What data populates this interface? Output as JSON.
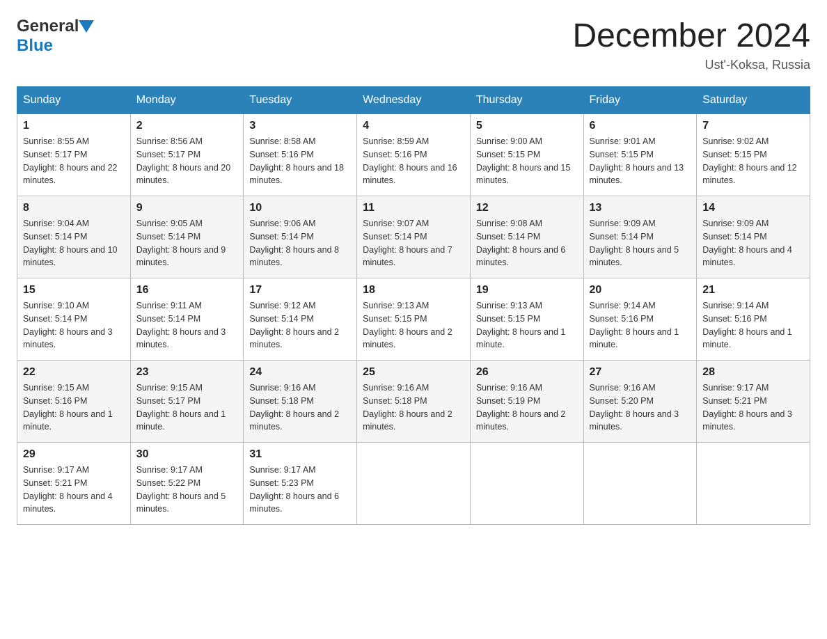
{
  "header": {
    "logo_general": "General",
    "logo_blue": "Blue",
    "month_title": "December 2024",
    "location": "Ust'-Koksa, Russia"
  },
  "days_of_week": [
    "Sunday",
    "Monday",
    "Tuesday",
    "Wednesday",
    "Thursday",
    "Friday",
    "Saturday"
  ],
  "weeks": [
    [
      {
        "day": "1",
        "sunrise": "8:55 AM",
        "sunset": "5:17 PM",
        "daylight": "8 hours and 22 minutes."
      },
      {
        "day": "2",
        "sunrise": "8:56 AM",
        "sunset": "5:17 PM",
        "daylight": "8 hours and 20 minutes."
      },
      {
        "day": "3",
        "sunrise": "8:58 AM",
        "sunset": "5:16 PM",
        "daylight": "8 hours and 18 minutes."
      },
      {
        "day": "4",
        "sunrise": "8:59 AM",
        "sunset": "5:16 PM",
        "daylight": "8 hours and 16 minutes."
      },
      {
        "day": "5",
        "sunrise": "9:00 AM",
        "sunset": "5:15 PM",
        "daylight": "8 hours and 15 minutes."
      },
      {
        "day": "6",
        "sunrise": "9:01 AM",
        "sunset": "5:15 PM",
        "daylight": "8 hours and 13 minutes."
      },
      {
        "day": "7",
        "sunrise": "9:02 AM",
        "sunset": "5:15 PM",
        "daylight": "8 hours and 12 minutes."
      }
    ],
    [
      {
        "day": "8",
        "sunrise": "9:04 AM",
        "sunset": "5:14 PM",
        "daylight": "8 hours and 10 minutes."
      },
      {
        "day": "9",
        "sunrise": "9:05 AM",
        "sunset": "5:14 PM",
        "daylight": "8 hours and 9 minutes."
      },
      {
        "day": "10",
        "sunrise": "9:06 AM",
        "sunset": "5:14 PM",
        "daylight": "8 hours and 8 minutes."
      },
      {
        "day": "11",
        "sunrise": "9:07 AM",
        "sunset": "5:14 PM",
        "daylight": "8 hours and 7 minutes."
      },
      {
        "day": "12",
        "sunrise": "9:08 AM",
        "sunset": "5:14 PM",
        "daylight": "8 hours and 6 minutes."
      },
      {
        "day": "13",
        "sunrise": "9:09 AM",
        "sunset": "5:14 PM",
        "daylight": "8 hours and 5 minutes."
      },
      {
        "day": "14",
        "sunrise": "9:09 AM",
        "sunset": "5:14 PM",
        "daylight": "8 hours and 4 minutes."
      }
    ],
    [
      {
        "day": "15",
        "sunrise": "9:10 AM",
        "sunset": "5:14 PM",
        "daylight": "8 hours and 3 minutes."
      },
      {
        "day": "16",
        "sunrise": "9:11 AM",
        "sunset": "5:14 PM",
        "daylight": "8 hours and 3 minutes."
      },
      {
        "day": "17",
        "sunrise": "9:12 AM",
        "sunset": "5:14 PM",
        "daylight": "8 hours and 2 minutes."
      },
      {
        "day": "18",
        "sunrise": "9:13 AM",
        "sunset": "5:15 PM",
        "daylight": "8 hours and 2 minutes."
      },
      {
        "day": "19",
        "sunrise": "9:13 AM",
        "sunset": "5:15 PM",
        "daylight": "8 hours and 1 minute."
      },
      {
        "day": "20",
        "sunrise": "9:14 AM",
        "sunset": "5:16 PM",
        "daylight": "8 hours and 1 minute."
      },
      {
        "day": "21",
        "sunrise": "9:14 AM",
        "sunset": "5:16 PM",
        "daylight": "8 hours and 1 minute."
      }
    ],
    [
      {
        "day": "22",
        "sunrise": "9:15 AM",
        "sunset": "5:16 PM",
        "daylight": "8 hours and 1 minute."
      },
      {
        "day": "23",
        "sunrise": "9:15 AM",
        "sunset": "5:17 PM",
        "daylight": "8 hours and 1 minute."
      },
      {
        "day": "24",
        "sunrise": "9:16 AM",
        "sunset": "5:18 PM",
        "daylight": "8 hours and 2 minutes."
      },
      {
        "day": "25",
        "sunrise": "9:16 AM",
        "sunset": "5:18 PM",
        "daylight": "8 hours and 2 minutes."
      },
      {
        "day": "26",
        "sunrise": "9:16 AM",
        "sunset": "5:19 PM",
        "daylight": "8 hours and 2 minutes."
      },
      {
        "day": "27",
        "sunrise": "9:16 AM",
        "sunset": "5:20 PM",
        "daylight": "8 hours and 3 minutes."
      },
      {
        "day": "28",
        "sunrise": "9:17 AM",
        "sunset": "5:21 PM",
        "daylight": "8 hours and 3 minutes."
      }
    ],
    [
      {
        "day": "29",
        "sunrise": "9:17 AM",
        "sunset": "5:21 PM",
        "daylight": "8 hours and 4 minutes."
      },
      {
        "day": "30",
        "sunrise": "9:17 AM",
        "sunset": "5:22 PM",
        "daylight": "8 hours and 5 minutes."
      },
      {
        "day": "31",
        "sunrise": "9:17 AM",
        "sunset": "5:23 PM",
        "daylight": "8 hours and 6 minutes."
      },
      null,
      null,
      null,
      null
    ]
  ]
}
